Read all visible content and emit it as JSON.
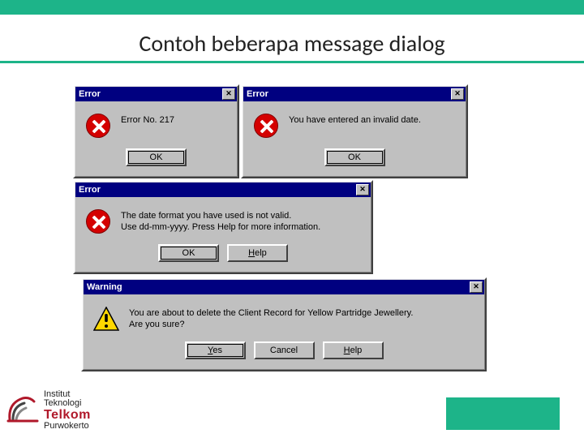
{
  "slide": {
    "title": "Contoh beberapa message dialog"
  },
  "dialogs": {
    "d1": {
      "title": "Error",
      "msg": "Error No. 217",
      "ok": "OK"
    },
    "d2": {
      "title": "Error",
      "msg": "You have entered an invalid date.",
      "ok": "OK"
    },
    "d3": {
      "title": "Error",
      "msg": "The date format you have used is not valid.\nUse dd-mm-yyyy.   Press Help for more information.",
      "ok": "OK",
      "help": "Help"
    },
    "d4": {
      "title": "Warning",
      "msg": "You are about to delete the Client Record for Yellow Partridge Jewellery.\nAre you sure?",
      "yes": "Yes",
      "cancel": "Cancel",
      "help": "Help"
    }
  },
  "footer": {
    "inst1": "Institut",
    "inst2": "Teknologi",
    "brand": "Telkom",
    "city": "Purwokerto"
  }
}
